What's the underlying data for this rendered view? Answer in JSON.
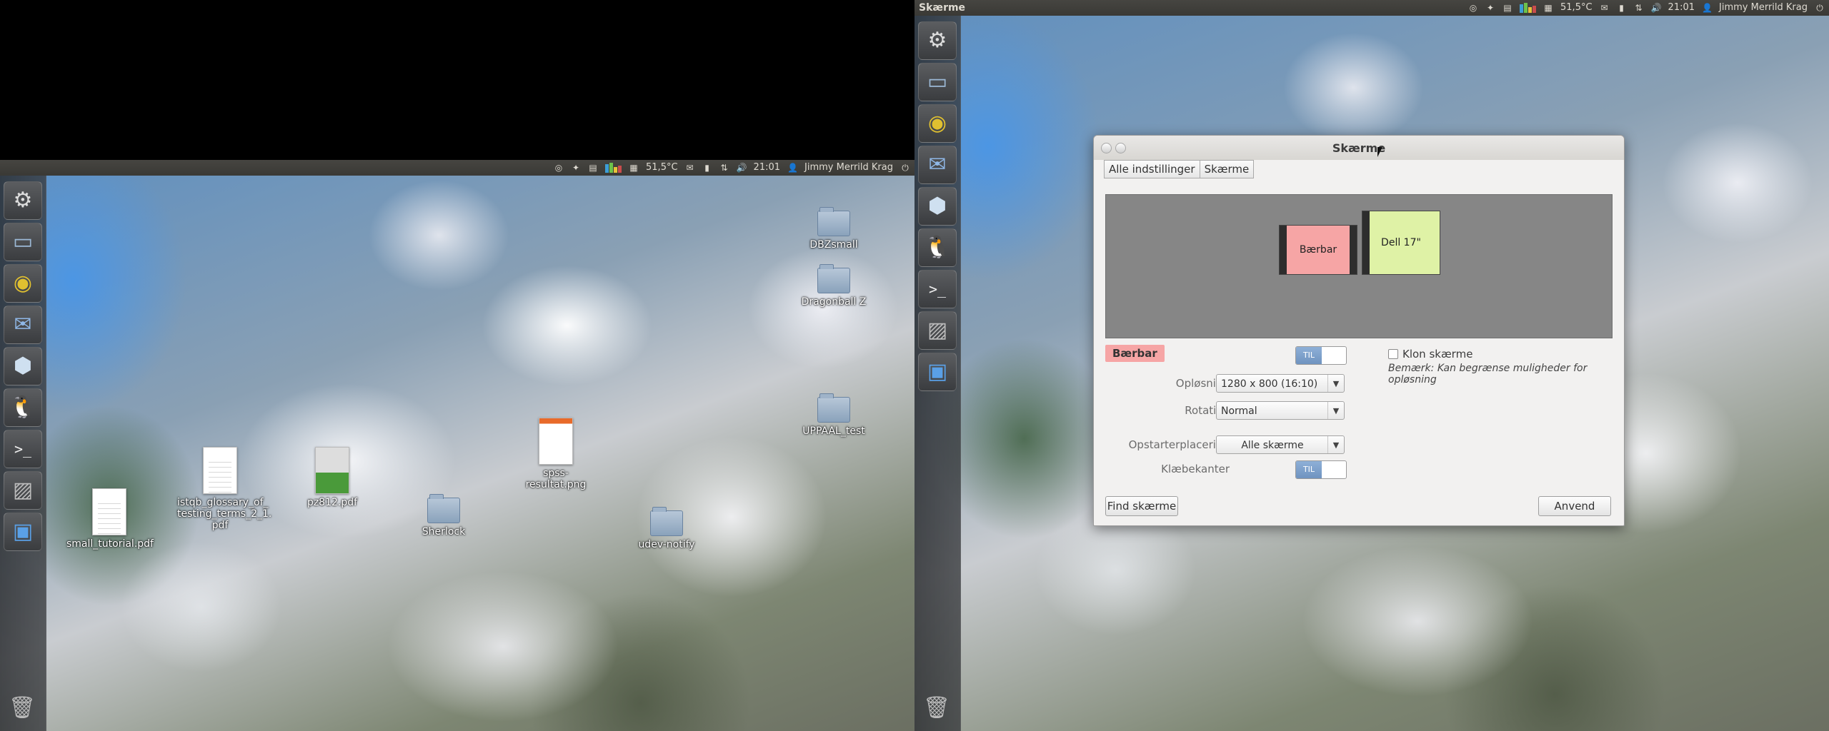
{
  "left_monitor": {
    "panel": {
      "temperature": "51,5°C",
      "time": "21:01",
      "user": "Jimmy Merrild Krag"
    },
    "desktop_icons": [
      {
        "label": "DBZsmall",
        "kind": "folder"
      },
      {
        "label": "Dragonball Z",
        "kind": "folder"
      },
      {
        "label": "UPPAAL_test",
        "kind": "folder"
      },
      {
        "label": "spss-resultat.png",
        "kind": "image"
      },
      {
        "label": "Sherlock",
        "kind": "folder"
      },
      {
        "label": "udev-notify",
        "kind": "folder"
      },
      {
        "label": "pz812.pdf",
        "kind": "pdf-photo"
      },
      {
        "label": "istqb_glossary_of_ testing_terms_2_1. pdf",
        "kind": "document"
      },
      {
        "label": "small_tutorial.pdf",
        "kind": "document"
      }
    ]
  },
  "right_monitor": {
    "panel": {
      "title": "Skærme",
      "temperature": "51,5°C",
      "time": "21:01",
      "user": "Jimmy Merrild Krag"
    }
  },
  "launcher_items": [
    "dash-icon",
    "files-icon",
    "chrome-icon",
    "thunderbird-icon",
    "virtualbox-icon",
    "tux-icon",
    "terminal-icon",
    "system-monitor-icon",
    "display-settings-icon",
    "trash-icon"
  ],
  "dialog": {
    "title": "Skærme",
    "breadcrumbs": [
      "Alle indstillinger",
      "Skærme"
    ],
    "monitors": {
      "laptop": "Bærbar",
      "external": "Dell 17\""
    },
    "selected_monitor_label": "Bærbar",
    "toggle_on_label": "TIL",
    "clone_label": "Klon skærme",
    "clone_checked": false,
    "clone_note": "Bemærk: Kan begrænse muligheder for opløsning",
    "resolution_label": "Opløsning",
    "resolution_value": "1280 x 800 (16:10)",
    "rotation_label": "Rotation",
    "rotation_value": "Normal",
    "launcher_placement_label": "Opstarterplacering",
    "launcher_placement_value": "Alle skærme",
    "sticky_edges_label": "Klæbekanter",
    "sticky_edges_label_on": "TIL",
    "detect_button": "Find skærme",
    "apply_button": "Anvend"
  },
  "colors": {
    "panel_bg": "#3c3b37",
    "laptop_box": "#f6a5a5",
    "dell_box": "#dff2a6",
    "toggle_on": "#7d9fcb"
  }
}
